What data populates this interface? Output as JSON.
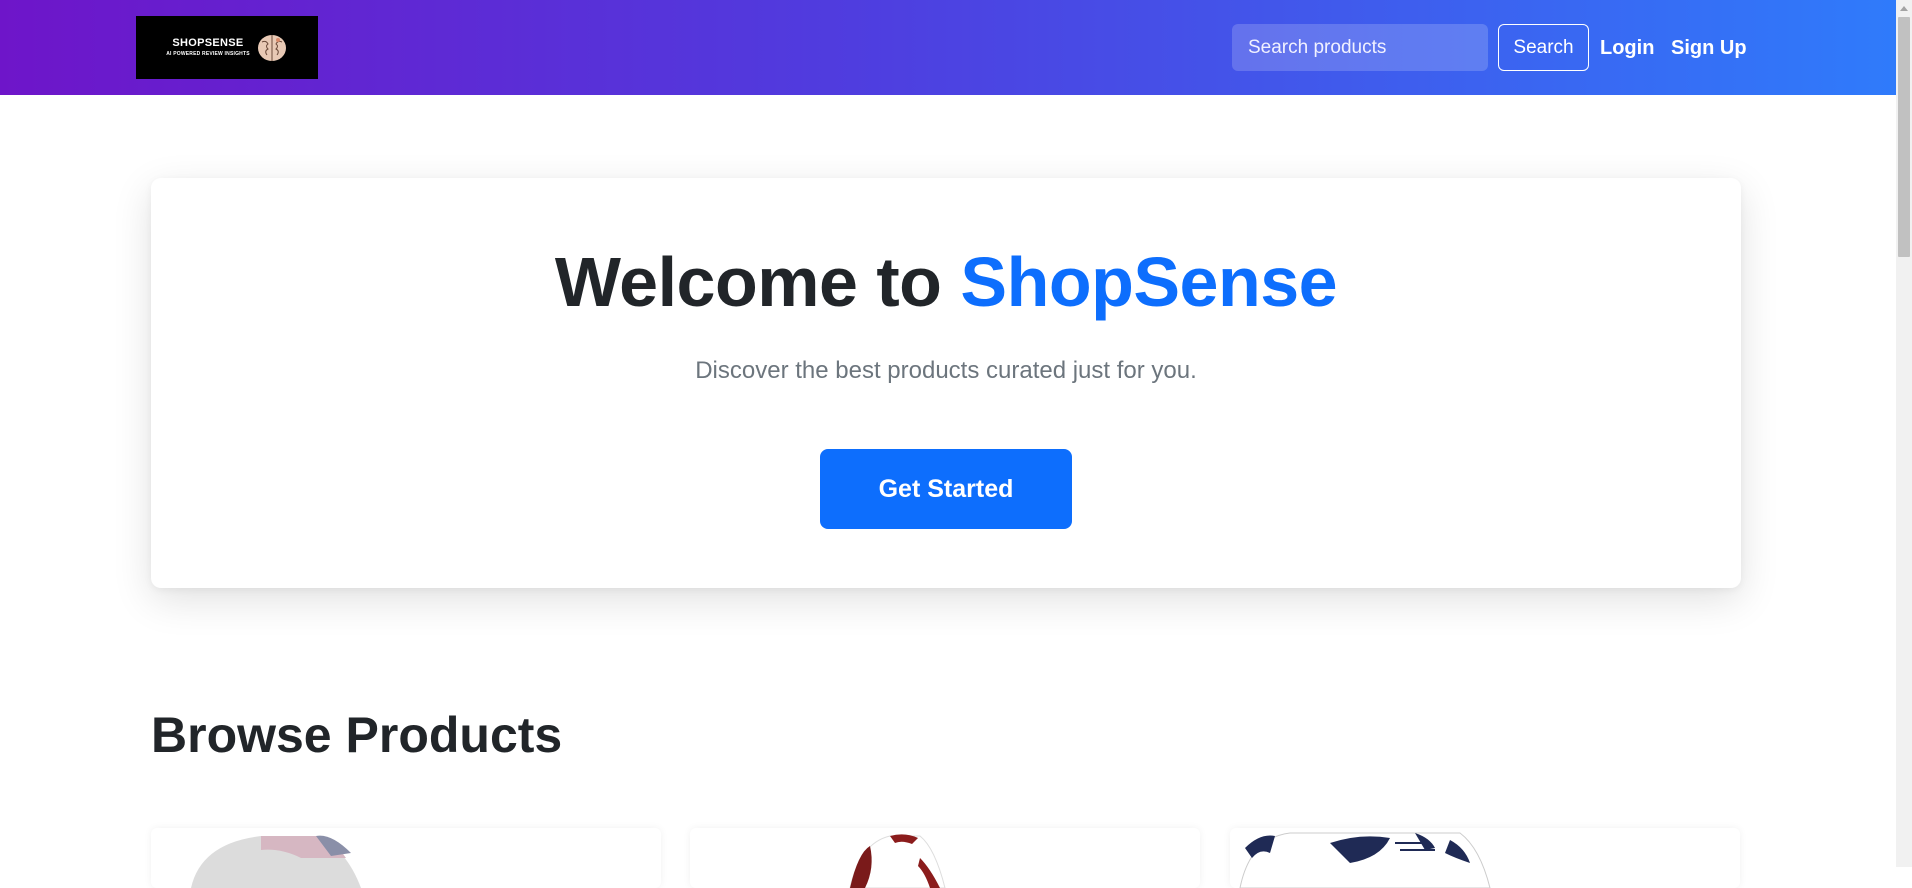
{
  "header": {
    "logo": {
      "title": "SHOPSENSE",
      "tagline": "AI POWERED REVIEW INSIGHTS",
      "icon": "brain-icon"
    },
    "search": {
      "placeholder": "Search products",
      "button_label": "Search"
    },
    "links": {
      "login": "Login",
      "signup": "Sign Up"
    }
  },
  "hero": {
    "title_prefix": "Welcome to ",
    "title_brand": "ShopSense",
    "subtitle": "Discover the best products curated just for you.",
    "cta_label": "Get Started"
  },
  "browse": {
    "title": "Browse Products",
    "products": [
      {
        "image": "sneaker-pink-image"
      },
      {
        "image": "sneaker-red-image"
      },
      {
        "image": "sneaker-navy-white-image"
      }
    ]
  },
  "colors": {
    "nav_gradient_start": "#6e15c9",
    "nav_gradient_end": "#2f7bfb",
    "brand_blue": "#0d6efd",
    "text_dark": "#212529",
    "text_muted": "#6c757d"
  }
}
